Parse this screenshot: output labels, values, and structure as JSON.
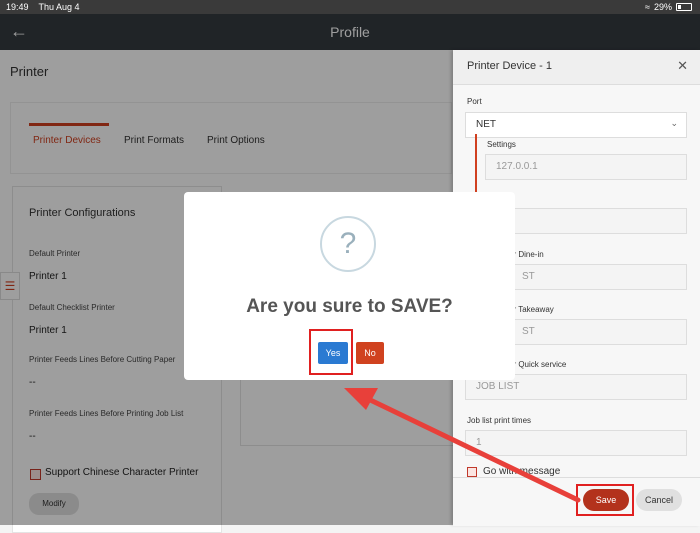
{
  "status_bar": {
    "time": "19:49",
    "date": "Thu Aug 4",
    "battery": "29%"
  },
  "header": {
    "title": "Profile",
    "back_icon": "arrow-left-icon"
  },
  "page": {
    "section_title": "Printer",
    "tabs": [
      {
        "label": "Printer Devices",
        "active": true
      },
      {
        "label": "Print Formats",
        "active": false
      },
      {
        "label": "Print Options",
        "active": false
      }
    ],
    "config": {
      "title": "Printer Configurations",
      "fields": [
        {
          "label": "Default Printer",
          "value": "Printer 1"
        },
        {
          "label": "Default Checklist Printer",
          "value": "Printer 1"
        },
        {
          "label": "Printer Feeds Lines Before Cutting Paper",
          "value": "--"
        },
        {
          "label": "Printer Feeds Lines Before Printing Job List",
          "value": "--"
        }
      ],
      "checkbox_label": "Support Chinese Character Printer",
      "modify_label": "Modify"
    }
  },
  "panel": {
    "title": "Printer Device - 1",
    "port_label": "Port",
    "port_value": "NET",
    "settings_label": "Settings",
    "settings_value": "127.0.0.1",
    "dinein_label": "or Dine-in",
    "dinein_value": "ST",
    "takeaway_label": "or Takeaway",
    "takeaway_value": "ST",
    "quick_label": "or Quick service",
    "quick_value": "JOB LIST",
    "times_label": "Job list print times",
    "times_value": "1",
    "check_label": "Go with message",
    "save_label": "Save",
    "cancel_label": "Cancel"
  },
  "dialog": {
    "icon": "question-mark-icon",
    "icon_glyph": "?",
    "message": "Are you sure to SAVE?",
    "yes_label": "Yes",
    "no_label": "No"
  },
  "colors": {
    "accent": "#d04020",
    "yes": "#2a7ad2",
    "highlight": "#e02020"
  }
}
